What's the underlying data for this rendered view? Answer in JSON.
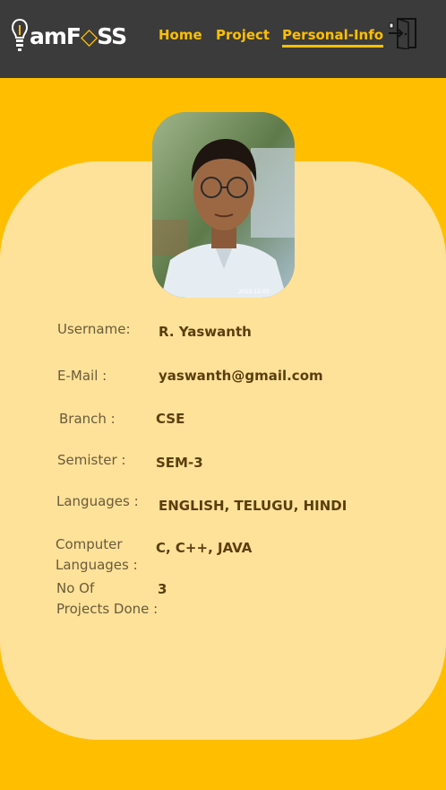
{
  "brand": {
    "logo_text_prefix": "am",
    "logo_text_accent": "F",
    "logo_text_diamond": "◇",
    "logo_text_suffix": "SS",
    "accent_color": "#FFBF00",
    "navbar_color": "#3B3B3B"
  },
  "nav": {
    "home": "Home",
    "project": "Project",
    "personal_info": "Personal-Info",
    "active": "personal_info",
    "logout_icon": "door-exit-icon"
  },
  "profile": {
    "photo_icon": "profile-photo",
    "photo_timestamp": "2022-12-07",
    "fields": [
      {
        "label": "Username:",
        "value": "R. Yaswanth"
      },
      {
        "label": "E-Mail :",
        "value": "yaswanth@gmail.com"
      },
      {
        "label": "Branch :",
        "value": "CSE"
      },
      {
        "label": "Semister :",
        "value": "SEM-3"
      },
      {
        "label": "Languages :",
        "value": "ENGLISH, TELUGU, HINDI"
      },
      {
        "label_line1": "Computer",
        "label_line2": "Languages :",
        "value": "C, C++, JAVA"
      },
      {
        "label_line1": "No Of",
        "label_line2": "Projects Done :",
        "value": "3"
      }
    ]
  }
}
